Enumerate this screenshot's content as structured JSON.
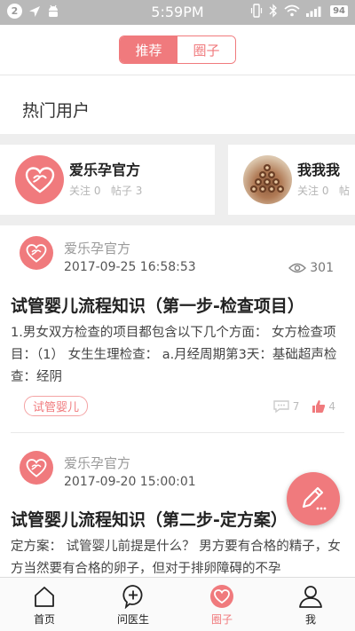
{
  "status_bar": {
    "notification_count": "2",
    "time": "5:59PM",
    "battery": "94"
  },
  "tabs": [
    {
      "label": "推荐",
      "active": true
    },
    {
      "label": "圈子",
      "active": false
    }
  ],
  "hot_users": {
    "title": "热门用户",
    "users": [
      {
        "name": "爱乐孕官方",
        "follow": "关注 0",
        "posts": "帖子 3",
        "avatar": "heart-logo-icon"
      },
      {
        "name": "我我我",
        "follow": "关注 0",
        "posts": "帖",
        "avatar": "pencils-photo"
      }
    ]
  },
  "posts": [
    {
      "author": "爱乐孕官方",
      "date": "2017-09-25 16:58:53",
      "views": "301",
      "title": "试管婴儿流程知识（第一步-检查项目）",
      "excerpt": "1.男女双方检查的项目都包含以下几个方面： 女方检查项目：（1） 女生生理检查： a.月经周期第3天：基础超声检查：经阴",
      "tag": "试管婴儿",
      "comments": "7",
      "likes": "4"
    },
    {
      "author": "爱乐孕官方",
      "date": "2017-09-20 15:00:01",
      "title": "试管婴儿流程知识（第二步-定方案）",
      "excerpt": "定方案： 试管婴儿前提是什么？ 男方要有合格的精子，女方当然要有合格的卵子，但对于排卵障碍的不孕"
    }
  ],
  "bottom_nav": [
    {
      "label": "首页",
      "icon": "home-icon",
      "active": false
    },
    {
      "label": "问医生",
      "icon": "ask-doctor-icon",
      "active": false
    },
    {
      "label": "圈子",
      "icon": "heart-circle-icon",
      "active": true
    },
    {
      "label": "我",
      "icon": "user-icon",
      "active": false
    }
  ],
  "colors": {
    "accent": "#f07a7d",
    "status_bar": "#b9b9b9"
  }
}
